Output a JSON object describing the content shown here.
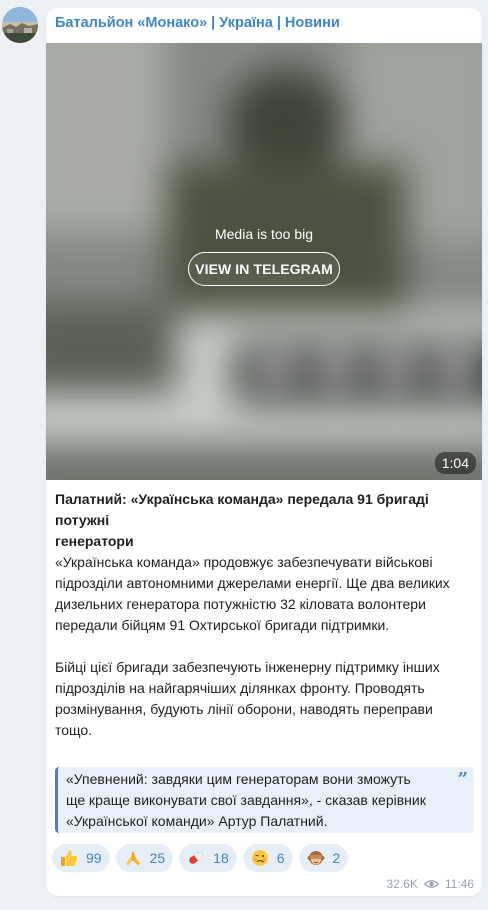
{
  "channel": {
    "name": "Батальйон «Монако» | Україна | Новини",
    "avatar_icon": "channel-avatar-icon"
  },
  "media": {
    "notice": "Media is too big",
    "button_label": "VIEW IN TELEGRAM",
    "duration": "1:04"
  },
  "post": {
    "headline_lines": [
      "Палатний: «Українська команда» передала 91 бригаді потужні",
      "генератори"
    ],
    "paragraph1_lines": [
      "«Українська команда» продовжує забезпечувати військові",
      "підрозділи автономними джерелами енергії. Ще два великих",
      "дизельних генератора потужністю 32 кіловата волонтери",
      "передали бійцям 91 Охтирської бригади підтримки."
    ],
    "paragraph2_lines": [
      "Бійці цієї бригади забезпечують інженерну підтримку інших",
      "підрозділів на найгарячіших ділянках фронту. Проводять",
      "розмінування, будують лінії оборони, наводять переправи",
      "тощо."
    ],
    "quote_lines": [
      "«Упевнений: завдяки цим генераторам вони зможуть",
      "ще краще виконувати свої завдання», - сказав керівник",
      "«Української команди» Артур Палатний."
    ],
    "quote_icon": "quote-icon"
  },
  "reactions": [
    {
      "icon": "thumbs-up-icon",
      "count": "99"
    },
    {
      "icon": "folded-hands-icon",
      "count": "25"
    },
    {
      "icon": "pill-icon",
      "count": "18"
    },
    {
      "icon": "woozy-face-icon",
      "count": "6"
    },
    {
      "icon": "see-no-evil-monkey-icon",
      "count": "2"
    }
  ],
  "meta": {
    "views": "32.6K",
    "views_icon": "eye-icon",
    "time": "11:46"
  },
  "colors": {
    "accent": "#3d87c8",
    "background": "#eef1f4",
    "quote_background": "#e8f1fa",
    "reaction_background": "#e6eef7"
  }
}
